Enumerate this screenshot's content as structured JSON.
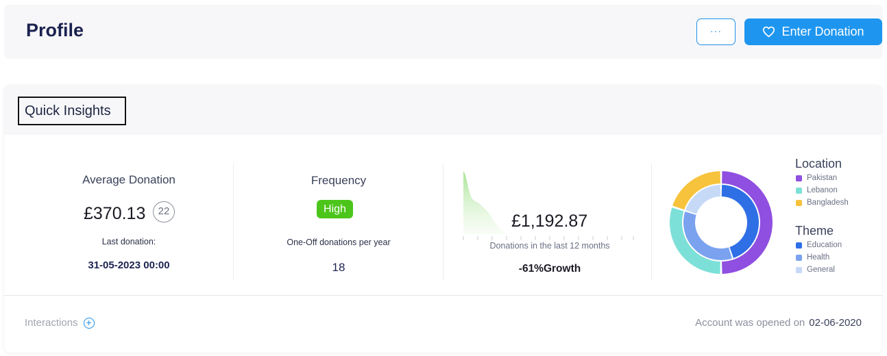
{
  "header": {
    "title": "Profile",
    "more_label": "···",
    "donate_label": "Enter Donation"
  },
  "insights": {
    "title": "Quick Insights",
    "average": {
      "label": "Average Donation",
      "value": "£370.13",
      "count": "22",
      "last_label": "Last donation:",
      "last_date": "31-05-2023 00:00"
    },
    "frequency": {
      "label": "Frequency",
      "badge": "High",
      "sub_label": "One-Off donations per year",
      "value": "18"
    },
    "trend": {
      "value": "£1,192.87",
      "sub_label": "Donations in the last 12 months",
      "growth": "-61%Growth"
    },
    "chart_data": {
      "type": "donut",
      "rings": [
        {
          "title": "Location",
          "items": [
            {
              "name": "Pakistan",
              "value": 50,
              "color": "#8f4fe0"
            },
            {
              "name": "Lebanon",
              "value": 30,
              "color": "#7de0d8"
            },
            {
              "name": "Bangladesh",
              "value": 20,
              "color": "#f7c33c"
            }
          ]
        },
        {
          "title": "Theme",
          "items": [
            {
              "name": "Education",
              "value": 45,
              "color": "#2f6fe6"
            },
            {
              "name": "Health",
              "value": 35,
              "color": "#7aa2ee"
            },
            {
              "name": "General",
              "value": 20,
              "color": "#c6daf8"
            }
          ]
        }
      ]
    }
  },
  "footer": {
    "interactions_label": "Interactions",
    "account_label": "Account was opened on",
    "account_date": "02-06-2020"
  },
  "colors": {
    "accent": "#1e96f0",
    "success": "#4cc51b"
  }
}
